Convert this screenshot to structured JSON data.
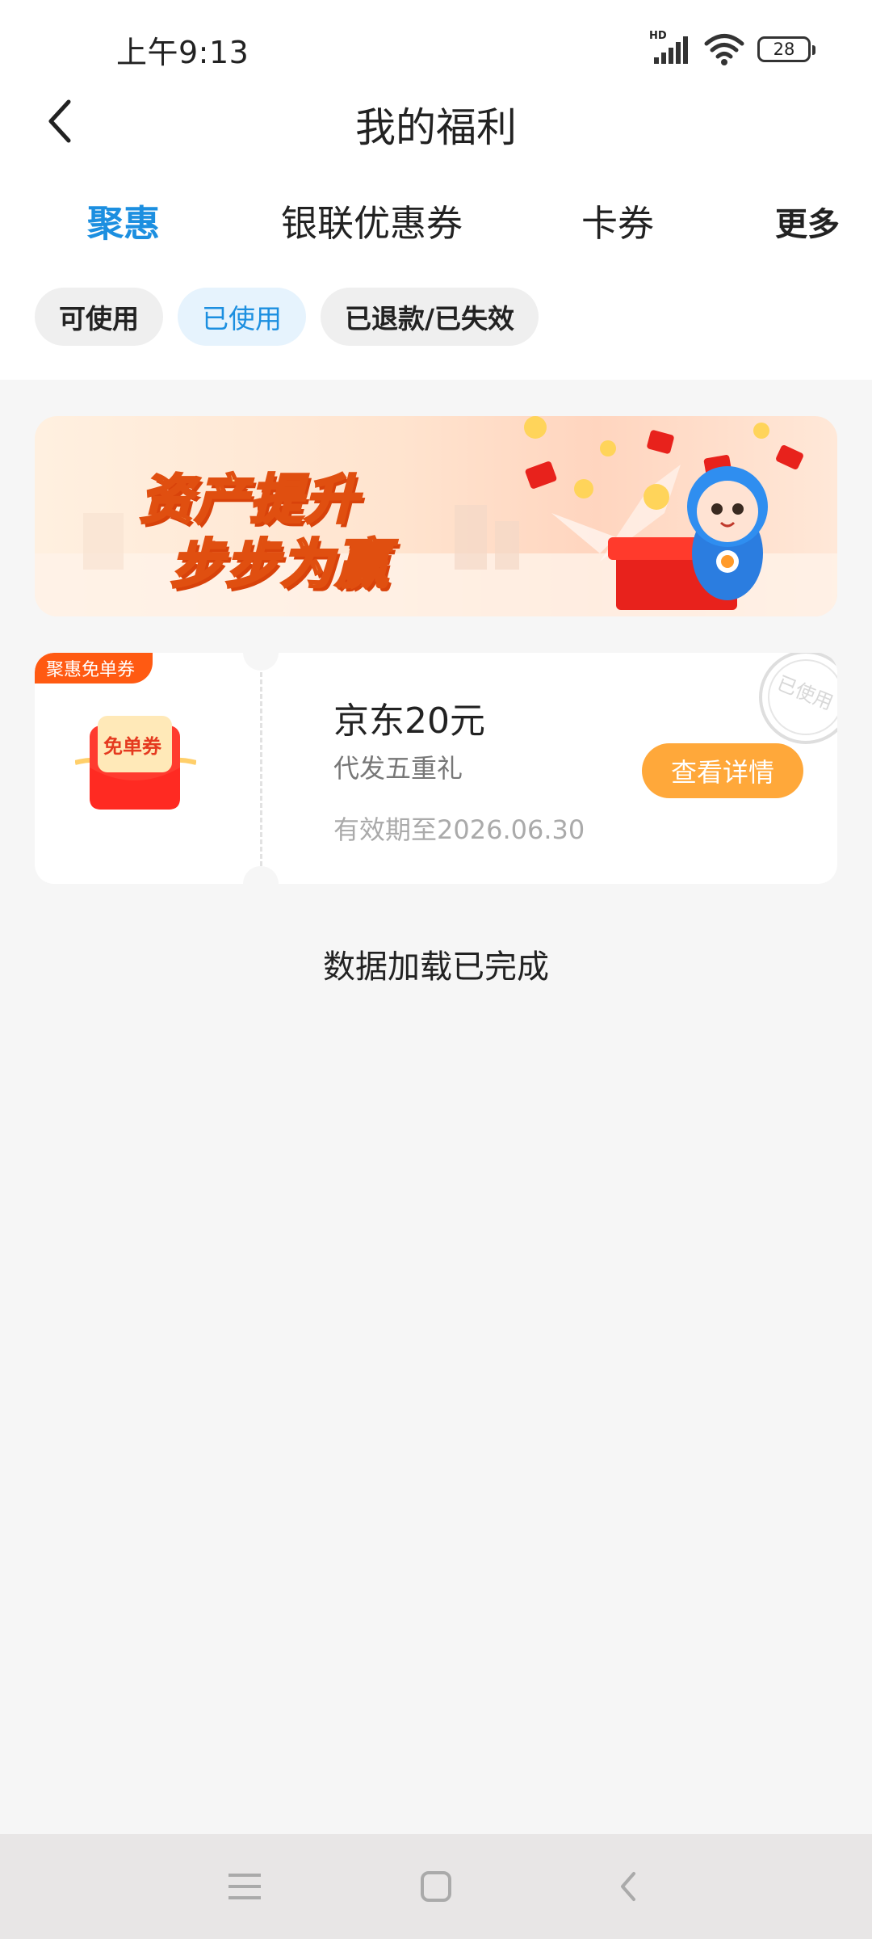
{
  "status_bar": {
    "time": "上午9:13",
    "network_label": "HD",
    "battery_level": "28",
    "icons": [
      "signal-icon",
      "wifi-icon",
      "battery-icon"
    ]
  },
  "header": {
    "title": "我的福利",
    "back_icon": "back-chevron-icon"
  },
  "tabs": [
    {
      "label": "聚惠",
      "active": true
    },
    {
      "label": "银联优惠券",
      "active": false
    },
    {
      "label": "卡券",
      "active": false
    },
    {
      "label": "更多",
      "active": false
    }
  ],
  "filters": [
    {
      "label": "可使用",
      "active": false
    },
    {
      "label": "已使用",
      "active": true
    },
    {
      "label": "已退款/已失效",
      "active": false
    }
  ],
  "banner": {
    "line1": "资产提升",
    "line2": "步步为赢"
  },
  "coupon": {
    "badge": "聚惠免单券",
    "image_label": "免单券",
    "title": "京东20元",
    "subtitle": "代发五重礼",
    "expiry": "有效期至2026.06.30",
    "button": "查看详情",
    "stamp": "已使用"
  },
  "load_status": "数据加载已完成",
  "nav_bar": {
    "icons": [
      "menu-icon",
      "home-icon",
      "back-icon"
    ]
  },
  "colors": {
    "accent": "#1c8fe0",
    "button": "#ffa83a",
    "badge": "#ff5a12",
    "background": "#f6f6f6"
  }
}
